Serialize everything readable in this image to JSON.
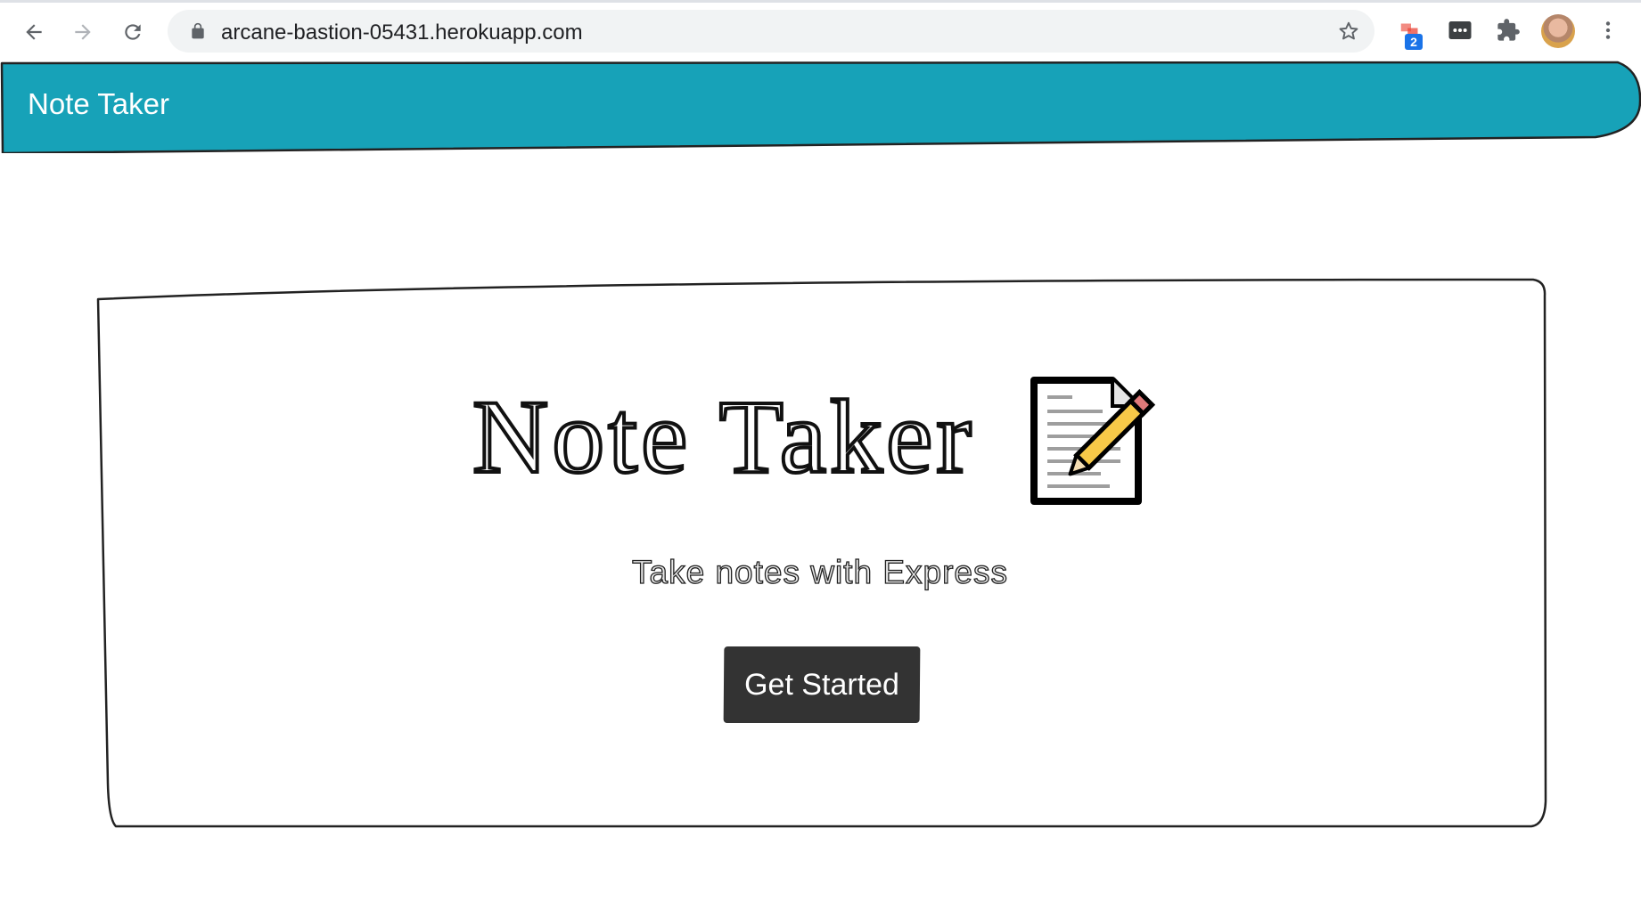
{
  "browser": {
    "url": "arcane-bastion-05431.herokuapp.com",
    "extension_badge": "2"
  },
  "navbar": {
    "brand": "Note Taker",
    "color": "#17a2b8"
  },
  "hero": {
    "title": "Note Taker",
    "subtitle": "Take notes with Express",
    "button_label": "Get Started",
    "icon": "memo-pencil-icon"
  }
}
